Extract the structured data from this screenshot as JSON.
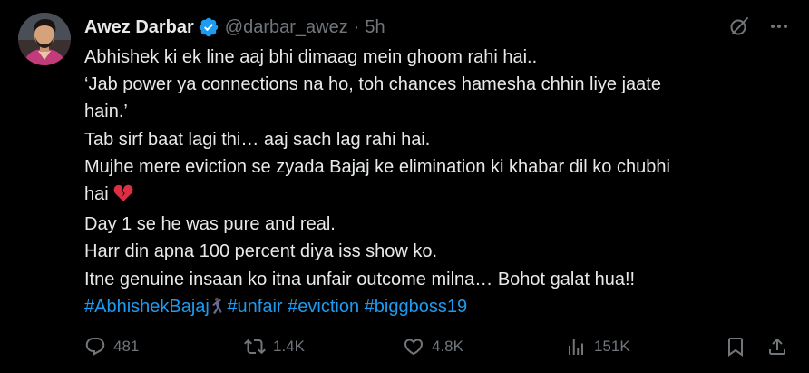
{
  "author": {
    "display_name": "Awez Darbar",
    "handle": "@darbar_awez",
    "separator": "·",
    "time": "5h",
    "verified": true
  },
  "colors": {
    "background": "#000000",
    "text": "#e7e9ea",
    "muted": "#71767b",
    "link": "#1d9bf0",
    "verified": "#1d9bf0"
  },
  "icons": {
    "verified": "verified-badge-icon",
    "grok": "grok-icon",
    "more": "more-horizontal-icon",
    "broken_heart": "broken-heart-emoji",
    "dancer": "dancer-emoji",
    "reply": "reply-icon",
    "repost": "repost-icon",
    "like": "heart-icon",
    "views": "views-chart-icon",
    "bookmark": "bookmark-icon",
    "share": "share-icon"
  },
  "tweet": {
    "lines": [
      "Abhishek ki ek line aaj bhi dimaag mein ghoom rahi hai..",
      "‘Jab power ya connections na ho, toh chances hamesha chhin liye jaate",
      "hain.’",
      "Tab sirf baat lagi thi… aaj sach lag rahi hai.",
      "Mujhe mere eviction se zyada Bajaj ke elimination ki khabar dil ko chubhi",
      "hai",
      "Day 1 se he was pure and real.",
      "Harr din apna 100 percent diya iss show ko.",
      "Itne genuine insaan ko itna unfair outcome milna… Bohot galat hua!!"
    ],
    "hashtags": [
      "#AbhishekBajaj",
      "#unfair",
      "#eviction",
      "#biggboss19"
    ]
  },
  "actions": {
    "replies": "481",
    "reposts": "1.4K",
    "likes": "4.8K",
    "views": "151K"
  }
}
